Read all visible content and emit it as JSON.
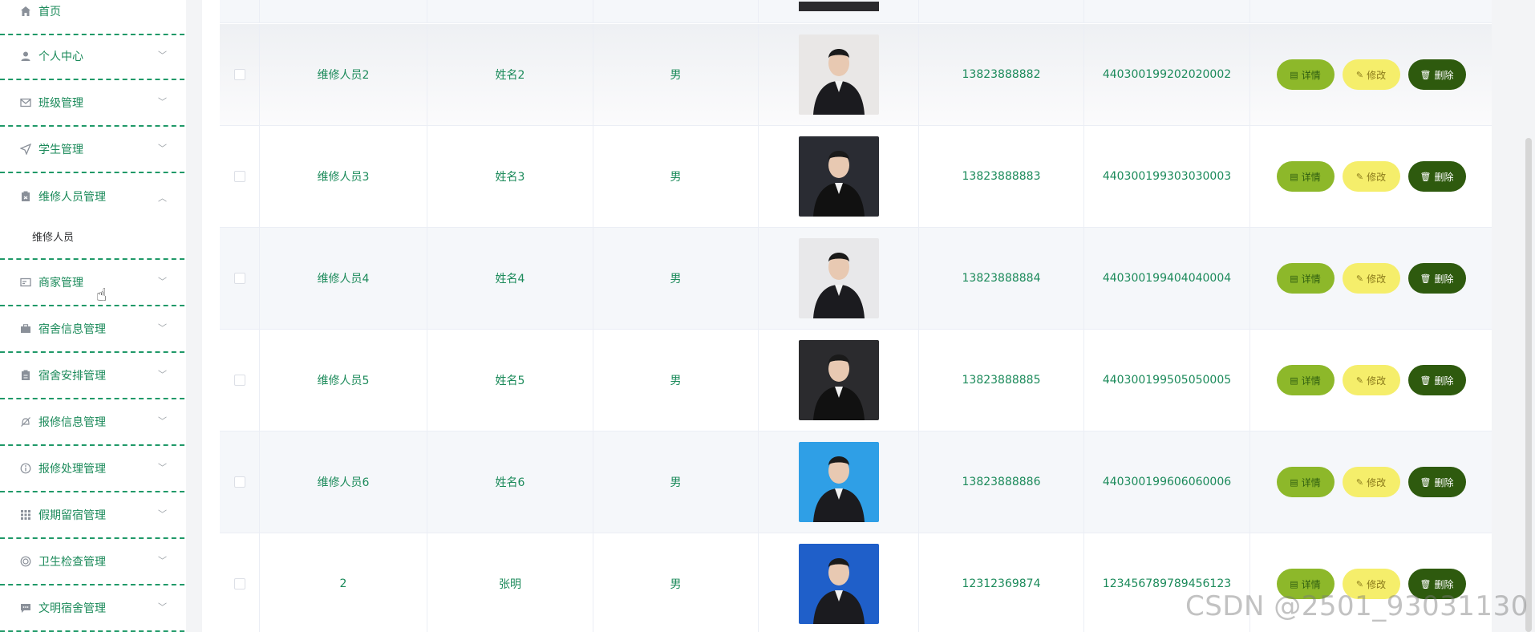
{
  "sidebar": {
    "home": "首页",
    "items": [
      {
        "label": "个人中心",
        "icon": "user-icon"
      },
      {
        "label": "班级管理",
        "icon": "mail-icon"
      },
      {
        "label": "学生管理",
        "icon": "send-icon"
      },
      {
        "label": "维修人员管理",
        "icon": "clipboard-icon"
      },
      {
        "label": "商家管理",
        "icon": "card-icon"
      },
      {
        "label": "宿舍信息管理",
        "icon": "briefcase-icon"
      },
      {
        "label": "宿舍安排管理",
        "icon": "clipboard-icon"
      },
      {
        "label": "报修信息管理",
        "icon": "bell-off-icon"
      },
      {
        "label": "报修处理管理",
        "icon": "info-icon"
      },
      {
        "label": "假期留宿管理",
        "icon": "grid-icon"
      },
      {
        "label": "卫生检查管理",
        "icon": "target-icon"
      },
      {
        "label": "文明宿舍管理",
        "icon": "chat-icon"
      }
    ],
    "sub_item": "维修人员"
  },
  "table": {
    "rows": [
      {
        "account": "维修人员2",
        "name": "姓名2",
        "gender": "男",
        "phone": "13823888882",
        "id": "440300199202020002",
        "photo_color": "#e9e7e6"
      },
      {
        "account": "维修人员3",
        "name": "姓名3",
        "gender": "男",
        "phone": "13823888883",
        "id": "440300199303030003",
        "photo_color": "#2a2c33"
      },
      {
        "account": "维修人员4",
        "name": "姓名4",
        "gender": "男",
        "phone": "13823888884",
        "id": "440300199404040004",
        "photo_color": "#e8e8ea"
      },
      {
        "account": "维修人员5",
        "name": "姓名5",
        "gender": "男",
        "phone": "13823888885",
        "id": "440300199505050005",
        "photo_color": "#2b2b2e"
      },
      {
        "account": "维修人员6",
        "name": "姓名6",
        "gender": "男",
        "phone": "13823888886",
        "id": "440300199606060006",
        "photo_color": "#2f9fe6"
      },
      {
        "account": "2",
        "name": "张明",
        "gender": "男",
        "phone": "12312369874",
        "id": "123456789789456123",
        "photo_color": "#1f5fc9"
      }
    ],
    "buttons": {
      "detail": "详情",
      "edit": "修改",
      "delete": "删除"
    }
  },
  "watermark": "CSDN @2501_93031130",
  "colors": {
    "accent": "#1b8a5a",
    "detail": "#8db82a",
    "edit": "#f5ee6b",
    "delete": "#2e5a0e"
  }
}
